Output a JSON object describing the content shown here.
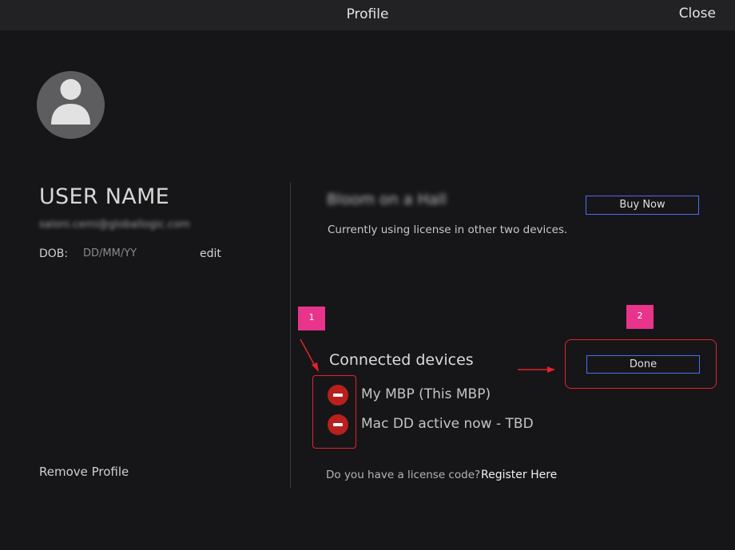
{
  "header": {
    "title": "Profile",
    "close_label": "Close"
  },
  "profile": {
    "avatar_icon": "user-avatar-icon",
    "username": "USER NAME",
    "email": "saloni.cemi@globallogic.com",
    "dob_label": "DOB:",
    "dob_value": "DD/MM/YY",
    "edit_label": "edit",
    "remove_label": "Remove Profile"
  },
  "license": {
    "plan_name": "Bloom on a Hall",
    "status_text": "Currently using license in other two devices.",
    "buy_now_label": "Buy Now"
  },
  "devices": {
    "heading": "Connected devices",
    "items": [
      {
        "label": "My MBP (This MBP)",
        "icon": "remove-circle-icon"
      },
      {
        "label": "Mac DD active now - TBD",
        "icon": "remove-circle-icon"
      }
    ],
    "done_label": "Done"
  },
  "register": {
    "question": "Do you have a license code?",
    "link_label": "Register Here"
  },
  "annotations": {
    "marker_1": "1",
    "marker_2": "2"
  },
  "colors": {
    "background": "#161618",
    "titlebar": "#222225",
    "button_border": "#4e6df0",
    "remove_icon": "#b8201d",
    "annotation_marker": "#e8348b",
    "annotation_outline": "#e3232a"
  }
}
